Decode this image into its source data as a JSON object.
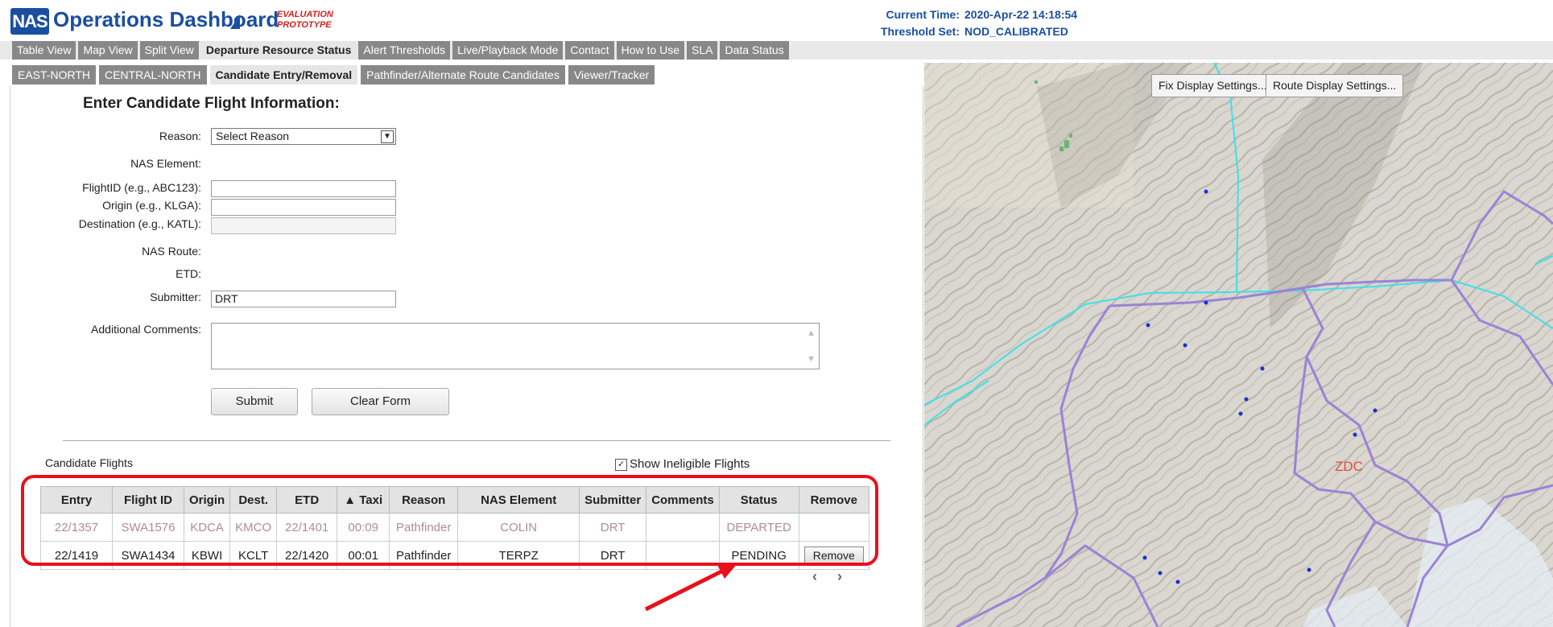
{
  "header": {
    "logo": "NAS",
    "title": "Operations Dashboard",
    "badge_line1": "EVALUATION",
    "badge_line2": "PROTOTYPE",
    "current_time_label": "Current Time:",
    "current_time": "2020-Apr-22 14:18:54",
    "threshold_label": "Threshold Set:",
    "threshold_value": "NOD_CALIBRATED"
  },
  "main_tabs": [
    {
      "label": "Table View"
    },
    {
      "label": "Map View"
    },
    {
      "label": "Split View"
    },
    {
      "label": "Departure Resource Status",
      "active": true
    },
    {
      "label": "Alert Thresholds"
    },
    {
      "label": "Live/Playback Mode"
    },
    {
      "label": "Contact"
    },
    {
      "label": "How to Use"
    },
    {
      "label": "SLA"
    },
    {
      "label": "Data Status"
    }
  ],
  "sub_tabs": [
    {
      "label": "EAST-NORTH"
    },
    {
      "label": "CENTRAL-NORTH"
    },
    {
      "label": "Candidate Entry/Removal",
      "active": true
    },
    {
      "label": "Pathfinder/Alternate Route Candidates"
    },
    {
      "label": "Viewer/Tracker"
    }
  ],
  "form": {
    "title": "Enter Candidate Flight Information:",
    "reason_label": "Reason:",
    "reason_value": "Select Reason",
    "nas_element_label": "NAS Element:",
    "flight_id_label": "FlightID (e.g., ABC123):",
    "origin_label": "Origin (e.g., KLGA):",
    "destination_label": "Destination (e.g., KATL):",
    "nas_route_label": "NAS Route:",
    "etd_label": "ETD:",
    "submitter_label": "Submitter:",
    "submitter_value": "DRT",
    "comments_label": "Additional Comments:",
    "submit_label": "Submit",
    "clear_label": "Clear Form"
  },
  "candidates": {
    "title": "Candidate Flights",
    "show_ineligible_label": "Show Ineligible Flights",
    "show_ineligible_checked": true,
    "columns": [
      "Entry",
      "Flight ID",
      "Origin",
      "Dest.",
      "ETD",
      "▲ Taxi",
      "Reason",
      "NAS Element",
      "Submitter",
      "Comments",
      "Status",
      "Remove"
    ],
    "rows": [
      {
        "entry": "22/1357",
        "flight_id": "SWA1576",
        "origin": "KDCA",
        "dest": "KMCO",
        "etd": "22/1401",
        "taxi": "00:09",
        "reason": "Pathfinder",
        "nas_element": "COLIN",
        "submitter": "DRT",
        "comments": "",
        "status": "DEPARTED",
        "remove": ""
      },
      {
        "entry": "22/1419",
        "flight_id": "SWA1434",
        "origin": "KBWI",
        "dest": "KCLT",
        "etd": "22/1420",
        "taxi": "00:01",
        "reason": "Pathfinder",
        "nas_element": "TERPZ",
        "submitter": "DRT",
        "comments": "",
        "status": "PENDING",
        "remove": "Remove"
      }
    ],
    "pager": "‹ ›"
  },
  "map": {
    "fix_btn": "Fix Display Settings...",
    "route_btn": "Route Display Settings...",
    "sector_label": "ZDC",
    "colors": {
      "boundary": "#9b83d6",
      "route": "#3fe0e8",
      "fix": "#1a2fd6"
    }
  },
  "annotation": {
    "highlight_color": "#e8101a"
  }
}
